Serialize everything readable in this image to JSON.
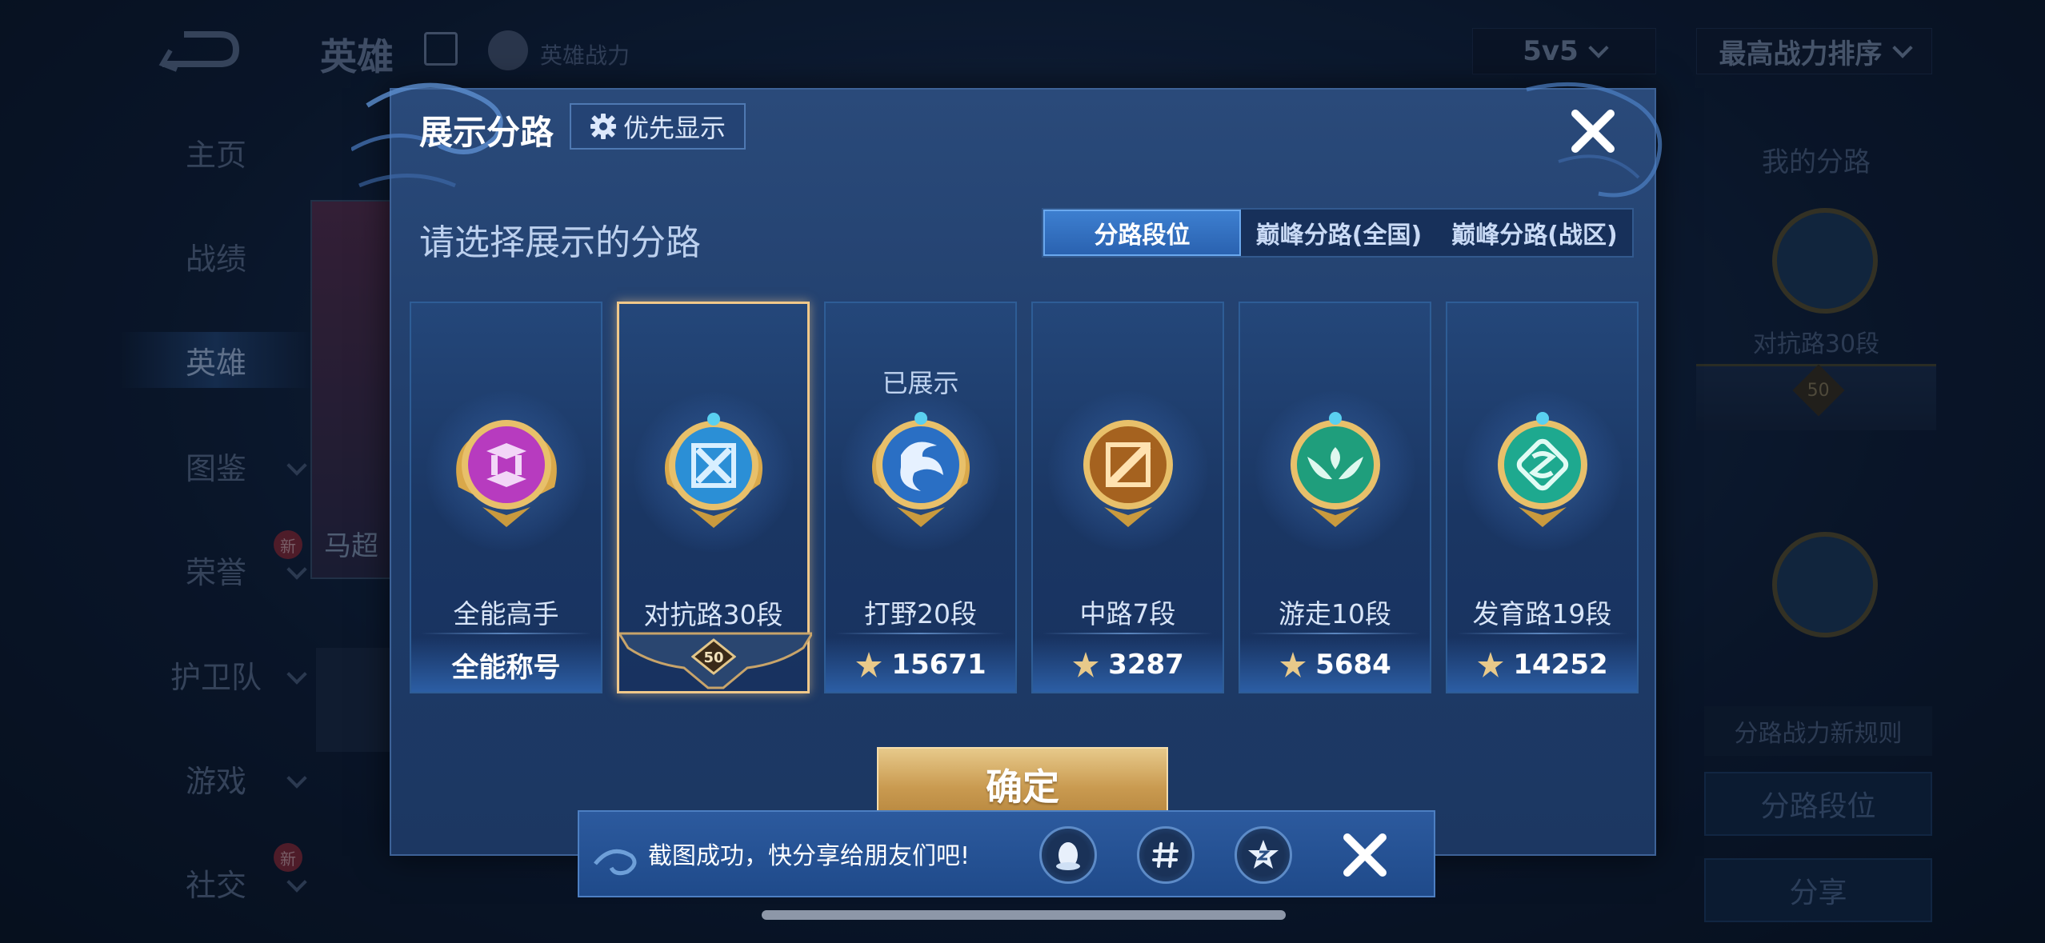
{
  "background": {
    "page_title": "英雄",
    "power_label": "英雄战力",
    "mode_select": "5v5",
    "sort_select": "最高战力排序",
    "nav": [
      "主页",
      "战绩",
      "英雄",
      "图鉴",
      "荣誉",
      "护卫队",
      "游戏",
      "社交"
    ],
    "nav_new_badge": "新",
    "hero_name": "马超",
    "right_panel": {
      "title": "我的分路",
      "emblem_label": "对抗路30段",
      "level": "50",
      "rules_button": "分路战力新规则",
      "lane_rank_button": "分路段位",
      "share_button": "分享"
    }
  },
  "dialog": {
    "title": "展示分路",
    "priority_button": "优先显示",
    "subtitle": "请选择展示的分路",
    "tabs": [
      "分路段位",
      "巅峰分路(全国)",
      "巅峰分路(战区)"
    ],
    "active_tab": "分路段位",
    "lanes": [
      {
        "name": "全能高手",
        "footer": "全能称号",
        "emblem_color": "#c04acb",
        "icon": "all-round-emblem-icon"
      },
      {
        "name": "对抗路30段",
        "footer_level": "50",
        "selected": true,
        "emblem_color": "#2b8fd6",
        "icon": "clash-lane-emblem-icon"
      },
      {
        "name": "打野20段",
        "power": "15671",
        "shown_label": "已展示",
        "emblem_color": "#2a6fc4",
        "icon": "jungle-emblem-icon"
      },
      {
        "name": "中路7段",
        "power": "3287",
        "emblem_color": "#d8892b",
        "icon": "mid-lane-emblem-icon"
      },
      {
        "name": "游走10段",
        "power": "5684",
        "emblem_color": "#1f9e7c",
        "icon": "roam-emblem-icon"
      },
      {
        "name": "发育路19段",
        "power": "14252",
        "emblem_color": "#1ea98f",
        "icon": "farm-lane-emblem-icon"
      }
    ],
    "confirm_button": "确定"
  },
  "toast": {
    "message": "截图成功，快分享给朋友们吧!",
    "share_targets": [
      "qq-icon",
      "moments-icon",
      "qzone-icon"
    ]
  },
  "colors": {
    "accent_blue": "#3d7fd0",
    "gold": "#e7c98a",
    "selected_border": "#f0c88a"
  }
}
